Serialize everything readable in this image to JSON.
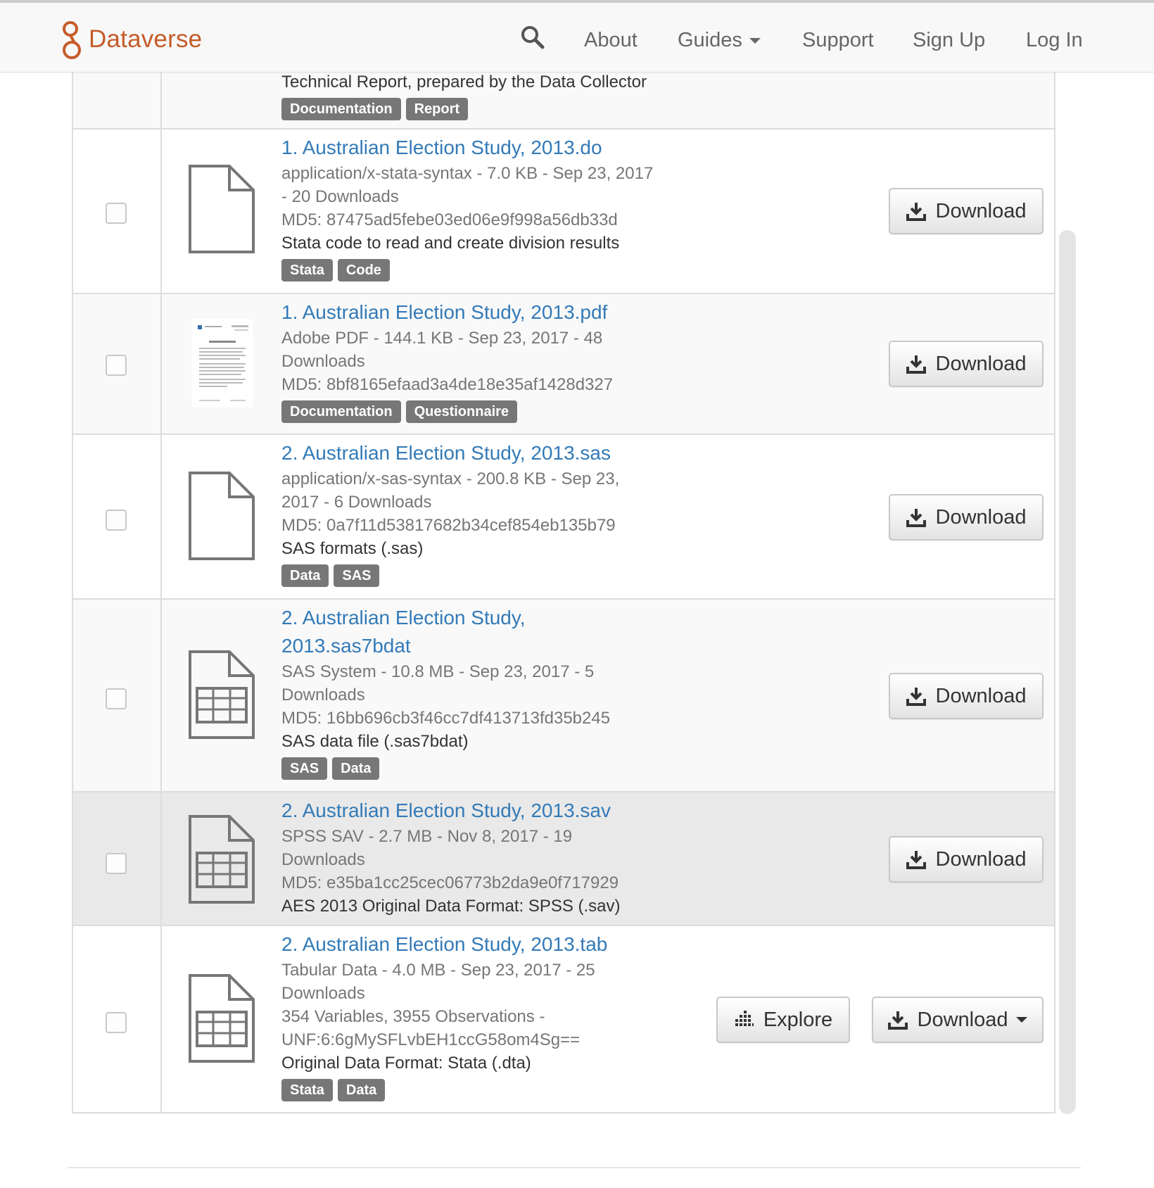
{
  "brand": {
    "name": "Dataverse",
    "color": "#c55b28"
  },
  "nav": {
    "search_icon": "magnifier-icon",
    "about": "About",
    "guides": "Guides",
    "support": "Support",
    "sign_up": "Sign Up",
    "log_in": "Log In"
  },
  "partial_row": {
    "description": "Technical Report, prepared by the Data Collector",
    "tags": [
      "Documentation",
      "Report"
    ]
  },
  "files": [
    {
      "name": "1. Australian Election Study, 2013.do",
      "meta_lines": [
        "application/x-stata-syntax - 7.0 KB - Sep 23, 2017",
        "- 20 Downloads",
        "MD5: 87475ad5febe03ed06e9f998a56db33d"
      ],
      "description": "Stata code to read and create division results",
      "tags": [
        "Stata",
        "Code"
      ],
      "icon": "file-icon",
      "download_label": "Download"
    },
    {
      "name": "1. Australian Election Study, 2013.pdf",
      "meta_lines": [
        "Adobe PDF - 144.1 KB - Sep 23, 2017 - 48",
        "Downloads",
        "MD5: 8bf8165efaad3a4de18e35af1428d327"
      ],
      "description": "",
      "tags": [
        "Documentation",
        "Questionnaire"
      ],
      "icon": "pdf-thumbnail",
      "download_label": "Download"
    },
    {
      "name": "2. Australian Election Study, 2013.sas",
      "meta_lines": [
        "application/x-sas-syntax - 200.8 KB - Sep 23,",
        "2017 - 6 Downloads",
        "MD5: 0a7f11d53817682b34cef854eb135b79"
      ],
      "description": "SAS formats (.sas)",
      "tags": [
        "Data",
        "SAS"
      ],
      "icon": "file-icon",
      "download_label": "Download"
    },
    {
      "name_lines": [
        "2. Australian Election Study,",
        "2013.sas7bdat"
      ],
      "meta_lines": [
        "SAS System - 10.8 MB - Sep 23, 2017 - 5",
        "Downloads",
        "MD5: 16bb696cb3f46cc7df413713fd35b245"
      ],
      "description": "SAS data file (.sas7bdat)",
      "tags": [
        "SAS",
        "Data"
      ],
      "icon": "table-file-icon",
      "download_label": "Download"
    },
    {
      "name": "2. Australian Election Study, 2013.sav",
      "meta_lines": [
        "SPSS SAV - 2.7 MB - Nov 8, 2017 - 19",
        "Downloads",
        "MD5: e35ba1cc25cec06773b2da9e0f717929"
      ],
      "description": "AES 2013 Original Data Format: SPSS (.sav)",
      "tags": [],
      "icon": "table-file-icon",
      "download_label": "Download"
    },
    {
      "name": "2. Australian Election Study, 2013.tab",
      "meta_lines": [
        "Tabular Data - 4.0 MB - Sep 23, 2017 - 25",
        "Downloads",
        "354 Variables, 3955 Observations -",
        "UNF:6:6gMySFLvbEH1ccG58om4Sg=="
      ],
      "description": "Original Data Format: Stata (.dta)",
      "tags": [
        "Stata",
        "Data"
      ],
      "icon": "table-file-icon",
      "explore_label": "Explore",
      "download_label": "Download"
    }
  ],
  "colors": {
    "link": "#337ab7",
    "tag_bg": "#777777",
    "muted_text": "#767676"
  }
}
